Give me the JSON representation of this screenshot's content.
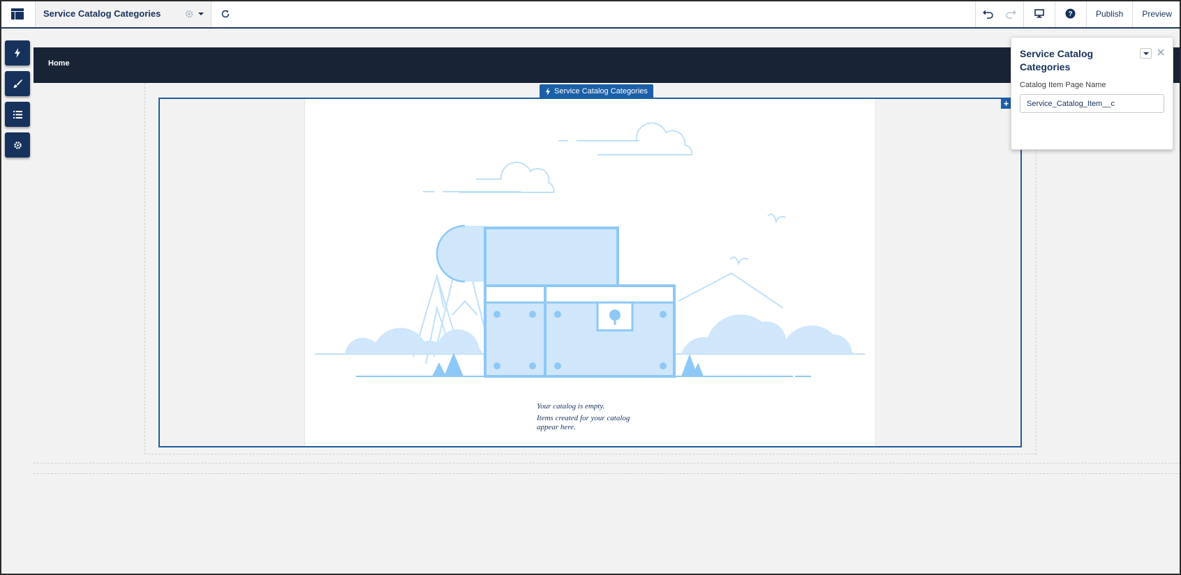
{
  "header": {
    "page_title": "Service Catalog Categories",
    "publish_label": "Publish",
    "preview_label": "Preview"
  },
  "icons": {
    "app": "layout-icon",
    "settings": "gear-icon",
    "dropdown": "chevron-down-icon",
    "refresh": "refresh-icon",
    "undo": "undo-icon",
    "redo": "redo-icon",
    "device": "desktop-icon",
    "help": "help-icon",
    "rail": [
      "lightning-icon",
      "brush-icon",
      "list-icon",
      "settings-icon"
    ]
  },
  "site": {
    "nav_home": "Home"
  },
  "component": {
    "tag_label": "Service Catalog Categories",
    "add_symbol": "+",
    "empty_line1": "Your catalog is empty.",
    "empty_line2": "Items created for your catalog",
    "empty_line3": "appear here."
  },
  "properties": {
    "title": "Service Catalog Categories",
    "field_label": "Catalog Item Page Name",
    "field_value": "Service_Catalog_Item__c"
  },
  "colors": {
    "brand_dark": "#16325c",
    "nav_bg": "#182336",
    "accent": "#1b5fa8",
    "illustration_fill": "#cfe6fb",
    "illustration_stroke": "#8ec8f6"
  }
}
